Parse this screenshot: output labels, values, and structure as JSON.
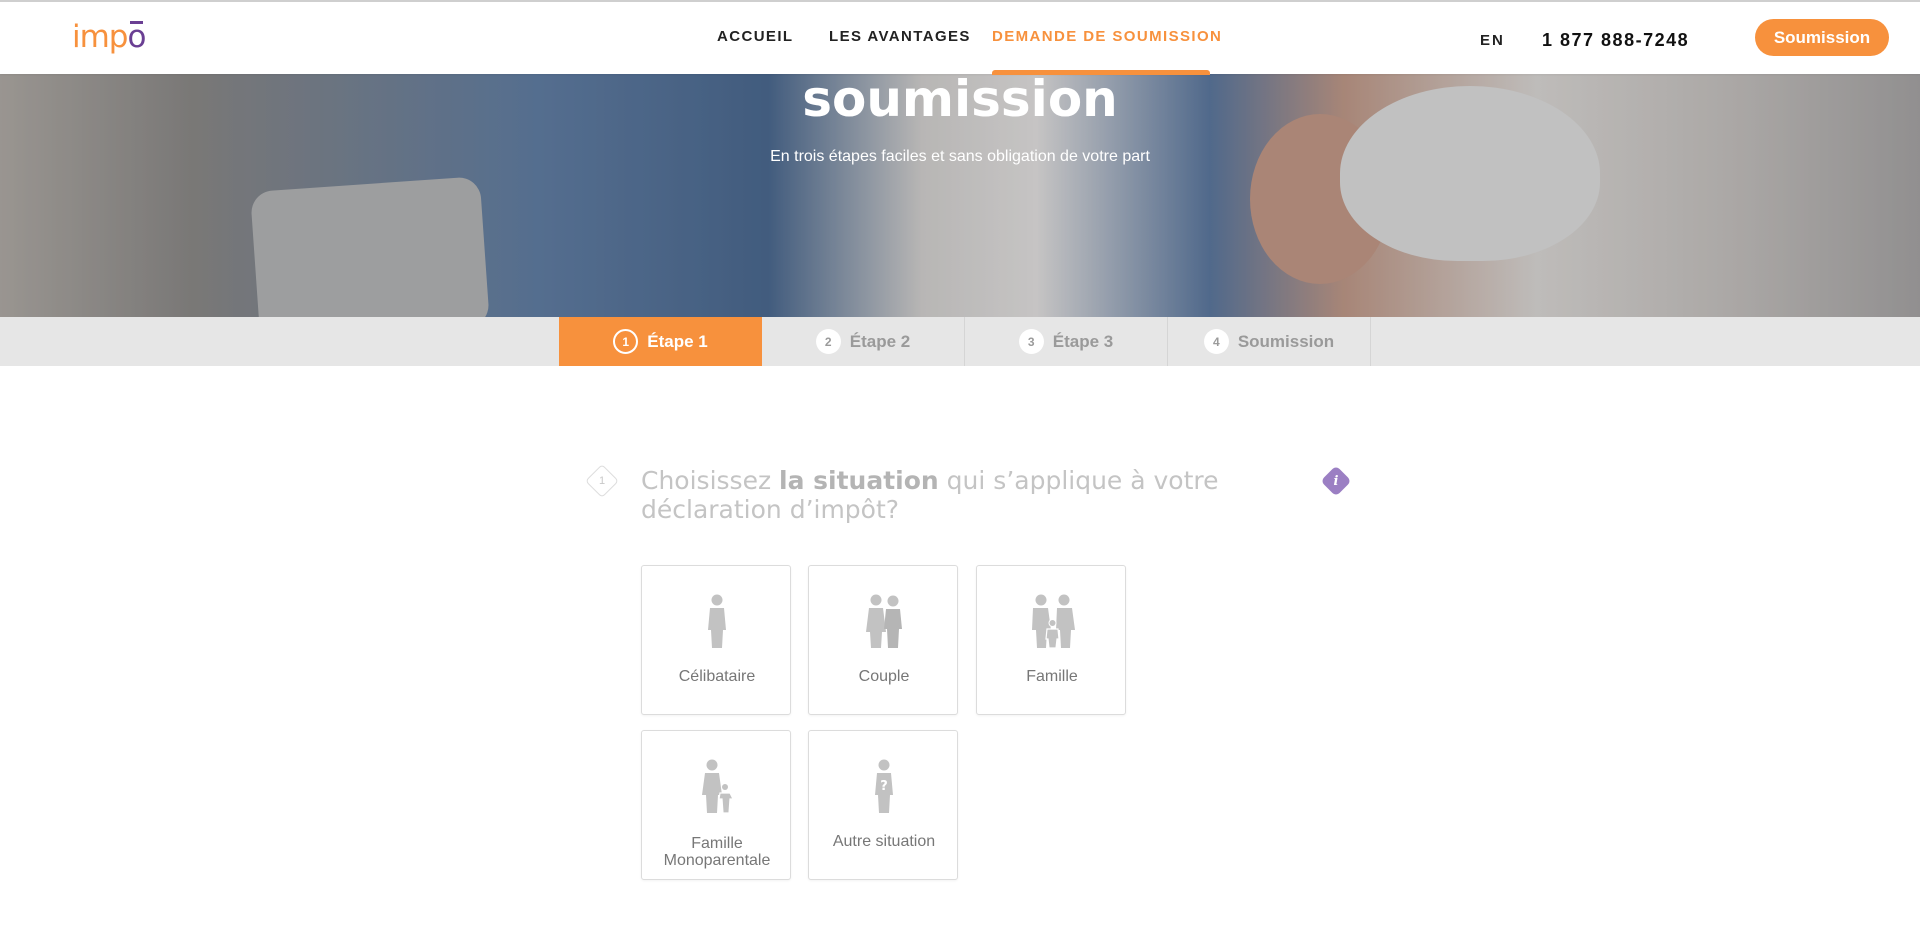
{
  "header": {
    "logo": {
      "part1": "imp",
      "part2": "o"
    },
    "nav": [
      {
        "label": "ACCUEIL",
        "active": false
      },
      {
        "label": "LES AVANTAGES",
        "active": false
      },
      {
        "label": "DEMANDE DE SOUMISSION",
        "active": true
      }
    ],
    "lang": "EN",
    "phone": "1 877 888-7248",
    "cta": "Soumission"
  },
  "hero": {
    "title": "soumission",
    "subtitle": "En trois étapes faciles et sans obligation de votre part"
  },
  "steps": [
    {
      "num": "1",
      "label": "Étape 1",
      "active": true
    },
    {
      "num": "2",
      "label": "Étape 2",
      "active": false
    },
    {
      "num": "3",
      "label": "Étape 3",
      "active": false
    },
    {
      "num": "4",
      "label": "Soumission",
      "active": false
    }
  ],
  "question": {
    "number": "1",
    "text_before": "Choisissez ",
    "text_bold": "la situation",
    "text_after": " qui s’applique à votre déclaration d’impôt?",
    "info_icon": "i"
  },
  "options": [
    {
      "label": "Célibataire",
      "icon": "single-person-icon"
    },
    {
      "label": "Couple",
      "icon": "couple-icon"
    },
    {
      "label": "Famille",
      "icon": "family-icon"
    },
    {
      "label_line1": "Famille",
      "label_line2": "Monoparentale",
      "icon": "single-parent-icon"
    },
    {
      "label": "Autre situation",
      "icon": "other-situation-icon"
    }
  ],
  "colors": {
    "accent": "#f7913d",
    "brand_purple": "#6a3f93",
    "info_purple": "#9b7fc3",
    "icon_gray": "#c2c2c2"
  }
}
